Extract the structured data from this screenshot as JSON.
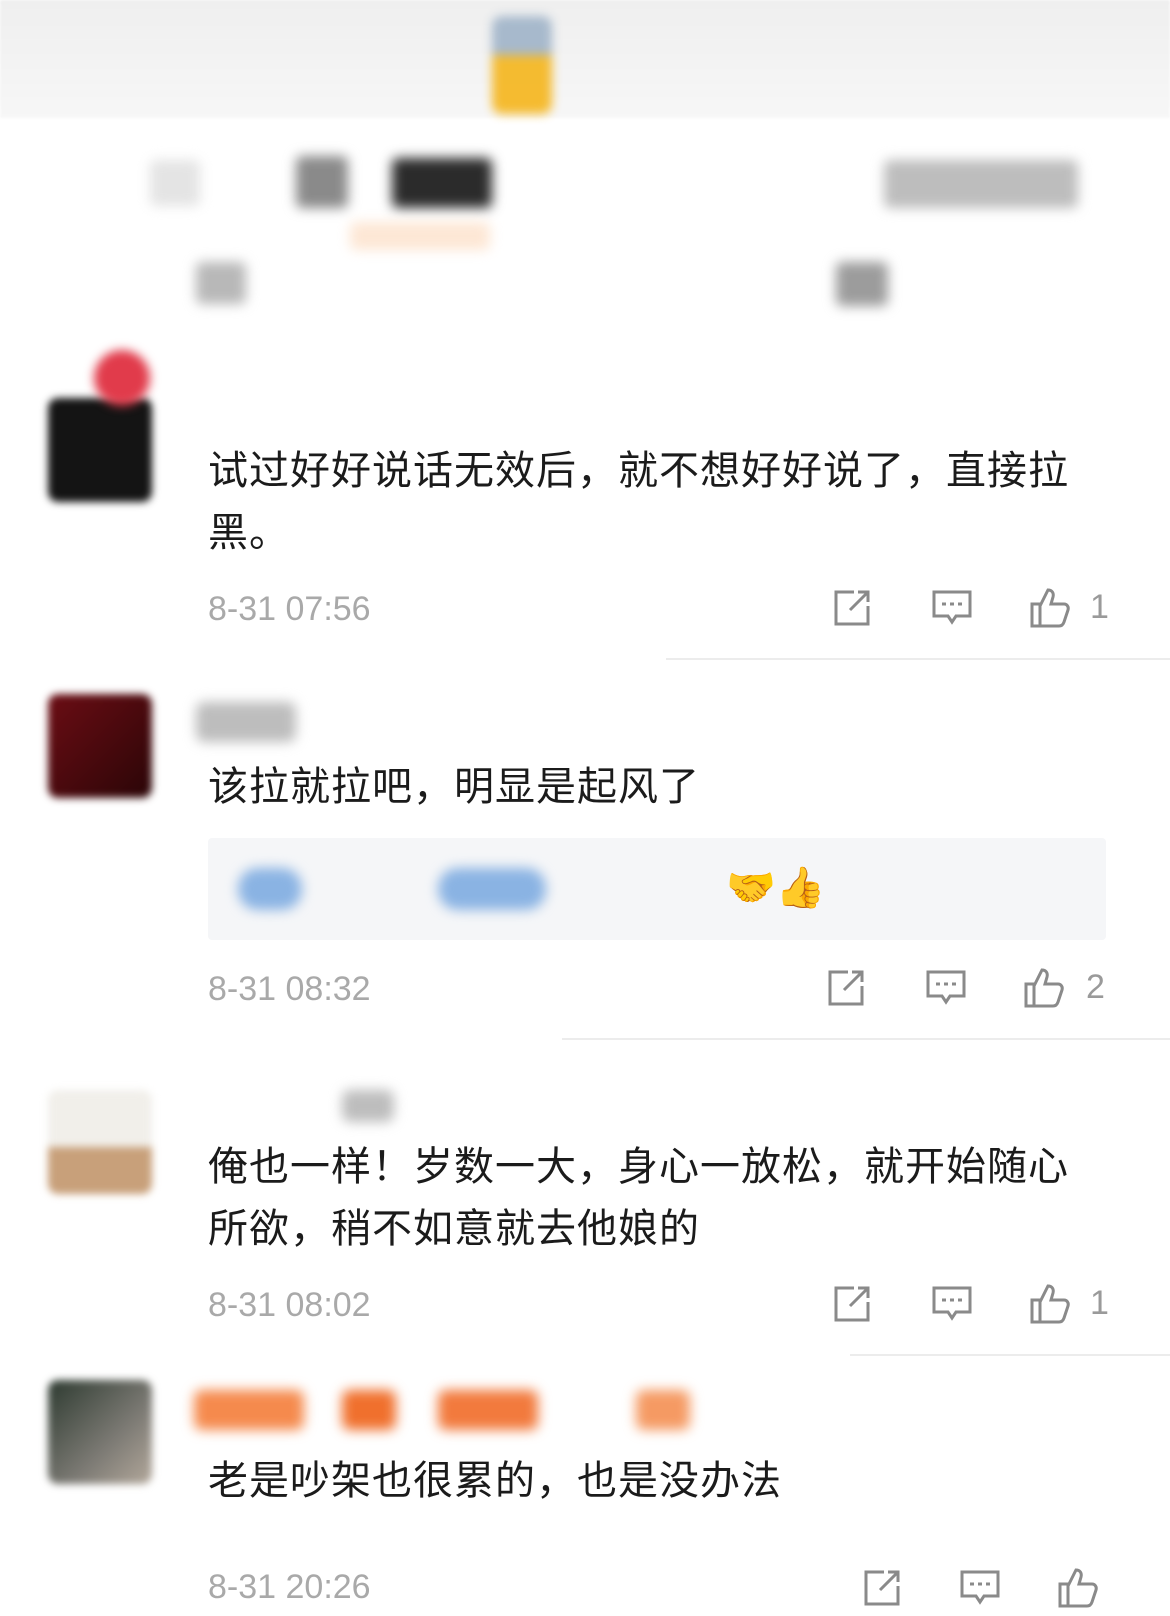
{
  "comments": [
    {
      "text": "试过好好说话无效后，就不想好好说了，直接拉黑。",
      "time": "8-31 07:56",
      "likes": "1"
    },
    {
      "text": "该拉就拉吧，明显是起风了",
      "time": "8-31 08:32",
      "likes": "2",
      "quote_emojis": "🤝👍"
    },
    {
      "text": "俺也一样！岁数一大，身心一放松，就开始随心所欲，稍不如意就去他娘的",
      "time": "8-31 08:02",
      "likes": "1"
    },
    {
      "text": "老是吵架也很累的，也是没办法",
      "time": "8-31 20:26"
    }
  ],
  "icons": {
    "share": "share-icon",
    "reply": "comment-icon",
    "like": "thumbs-up-icon"
  },
  "colors": {
    "text": "#1b1b1b",
    "meta": "#a9a9a9",
    "icon": "#8a8a8a"
  }
}
